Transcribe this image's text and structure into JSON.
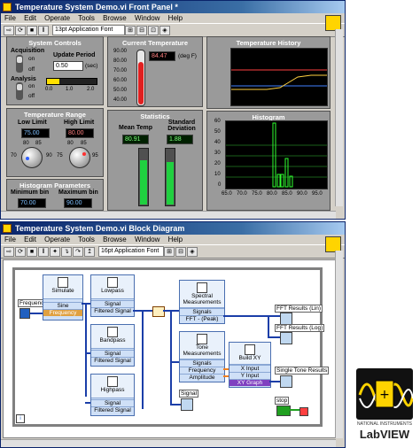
{
  "front_panel": {
    "title": "Temperature System Demo.vi Front Panel *",
    "menu": [
      "File",
      "Edit",
      "Operate",
      "Tools",
      "Browse",
      "Window",
      "Help"
    ],
    "font_select": "13pt Application Font",
    "system_controls": {
      "title": "System Controls",
      "acquisition_label": "Acquisition",
      "acq_on": "on",
      "acq_off": "off",
      "update_label": "Update Period",
      "update_value": "0.50",
      "update_unit": "(sec)",
      "analysis_label": "Analysis",
      "an_on": "on",
      "an_off": "off",
      "slider_ticks": [
        "0.0",
        "1.0",
        "2.0"
      ]
    },
    "temperature_range": {
      "title": "Temperature Range",
      "low_label": "Low Limit",
      "low_value": "75.00",
      "high_label": "High Limit",
      "high_value": "80.00",
      "low_knob_ticks": [
        "80",
        "85",
        "70",
        "90"
      ],
      "high_knob_ticks": [
        "80",
        "85",
        "75",
        "95"
      ]
    },
    "histogram_params": {
      "title": "Histogram Parameters",
      "min_label": "Minimum bin",
      "min_value": "70.00",
      "max_label": "Maximum bin",
      "max_value": "90.00"
    },
    "current_temp": {
      "title": "Current Temperature",
      "value": "84.47",
      "unit": "(deg F)",
      "ticks": [
        "90.00",
        "80.00",
        "70.00",
        "60.00",
        "50.00",
        "40.00"
      ]
    },
    "statistics": {
      "title": "Statistics",
      "mean_label": "Mean Temp",
      "mean_value": "80.91",
      "std_label": "Standard Deviation",
      "std_value": "1.88"
    },
    "history": {
      "title": "Temperature History"
    },
    "histogram": {
      "title": "Histogram",
      "yticks": [
        "60",
        "50",
        "40",
        "30",
        "20",
        "10",
        "0"
      ],
      "xticks": [
        "65.0",
        "70.0",
        "75.0",
        "80.0",
        "85.0",
        "90.0",
        "95.0"
      ]
    }
  },
  "block_diagram": {
    "title": "Temperature System Demo.vi Block Diagram",
    "menu": [
      "File",
      "Edit",
      "Operate",
      "Tools",
      "Browse",
      "Window",
      "Help"
    ],
    "font_select": "16pt Application Font",
    "frequency_label": "Frequency",
    "simulate": {
      "title": "Simulate",
      "row1": "Sine",
      "row2": "Frequency"
    },
    "lowpass": {
      "title": "Lowpass",
      "row1": "Signal",
      "row2": "Filtered Signal"
    },
    "bandpass": {
      "title": "Bandpass",
      "row1": "Signal",
      "row2": "Filtered Signal"
    },
    "highpass": {
      "title": "Highpass",
      "row1": "Signal",
      "row2": "Filtered Signal"
    },
    "spectral": {
      "title": "Spectral Measurements",
      "row1": "Signals",
      "row2": "FFT - (Peak)"
    },
    "tone": {
      "title": "Tone Measurements",
      "row1": "Signals",
      "row2": "Frequency",
      "row3": "Amplitude"
    },
    "buildxy": {
      "title": "Build XY",
      "row1": "X Input",
      "row2": "Y Input",
      "row3": "XY Graph"
    },
    "fft_lin": "FFT Results (Lin)",
    "fft_log": "FFT Results (Log)",
    "single_tone": "Single Tone Results",
    "signal_label": "Signal",
    "stop_label": "stop"
  },
  "logo": {
    "line1": "NATIONAL INSTRUMENTS",
    "line2": "LabVIEW"
  },
  "colors": {
    "title_bar": "#0a246a",
    "panel_gray": "#9a9a9a",
    "thermometer_red": "#e02020",
    "gauge_green": "#20d040",
    "wire_blue": "#1b3ea8",
    "wire_orange": "#f08020"
  }
}
